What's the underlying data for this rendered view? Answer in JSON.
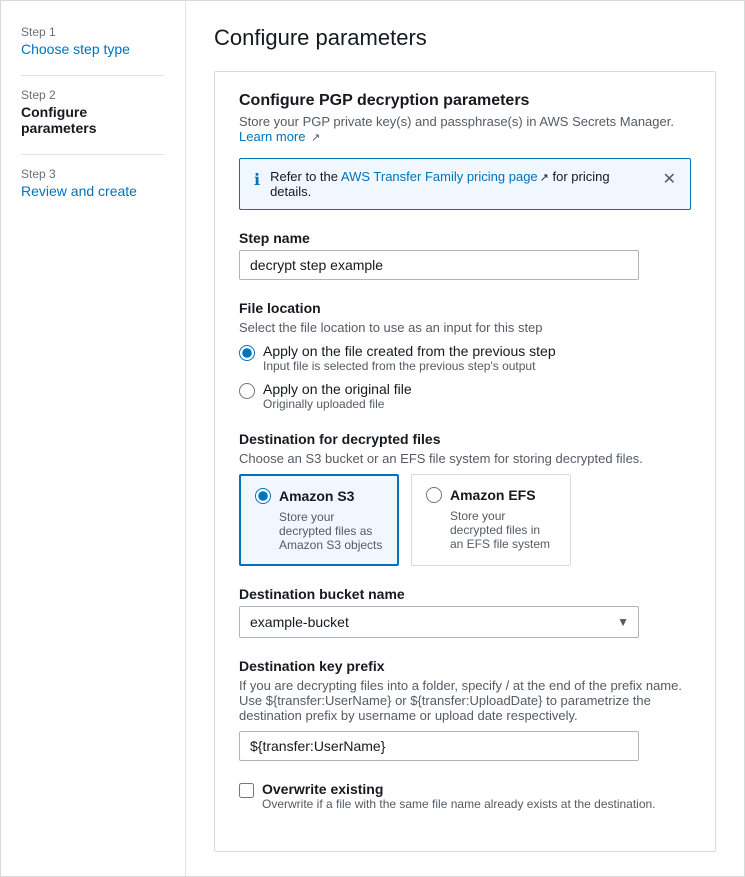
{
  "sidebar": {
    "steps": [
      {
        "id": "step1",
        "label": "Step 1",
        "title": "Choose step type",
        "active": false,
        "link": true
      },
      {
        "id": "step2",
        "label": "Step 2",
        "title": "Configure parameters",
        "active": true,
        "link": false
      },
      {
        "id": "step3",
        "label": "Step 3",
        "title": "Review and create",
        "active": false,
        "link": false
      }
    ]
  },
  "main": {
    "page_title": "Configure parameters",
    "section": {
      "heading": "Configure PGP decryption parameters",
      "subtext": "Store your PGP private key(s) and passphrase(s) in AWS Secrets Manager.",
      "learn_more_label": "Learn more",
      "banner": {
        "text_prefix": "Refer to the ",
        "link_label": "AWS Transfer Family pricing page",
        "text_suffix": " for pricing details."
      },
      "step_name": {
        "label": "Step name",
        "value": "decrypt step example"
      },
      "file_location": {
        "label": "File location",
        "desc": "Select the file location to use as an input for this step",
        "options": [
          {
            "id": "prev-step",
            "label": "Apply on the file created from the previous step",
            "sublabel": "Input file is selected from the previous step's output",
            "checked": true
          },
          {
            "id": "original-file",
            "label": "Apply on the original file",
            "sublabel": "Originally uploaded file",
            "checked": false
          }
        ]
      },
      "destination": {
        "label": "Destination for decrypted files",
        "desc": "Choose an S3 bucket or an EFS file system for storing decrypted files.",
        "options": [
          {
            "id": "amazon-s3",
            "title": "Amazon S3",
            "desc": "Store your decrypted files as Amazon S3 objects",
            "selected": true
          },
          {
            "id": "amazon-efs",
            "title": "Amazon EFS",
            "desc": "Store your decrypted files in an EFS file system",
            "selected": false
          }
        ]
      },
      "bucket_name": {
        "label": "Destination bucket name",
        "value": "example-bucket",
        "options": [
          "example-bucket"
        ]
      },
      "key_prefix": {
        "label": "Destination key prefix",
        "desc": "If you are decrypting files into a folder, specify / at the end of the prefix name. Use ${transfer:UserName} or ${transfer:UploadDate} to parametrize the destination prefix by username or upload date respectively.",
        "value": "${transfer:UserName}"
      },
      "overwrite": {
        "label": "Overwrite existing",
        "desc": "Overwrite if a file with the same file name already exists at the destination.",
        "checked": false
      }
    }
  }
}
